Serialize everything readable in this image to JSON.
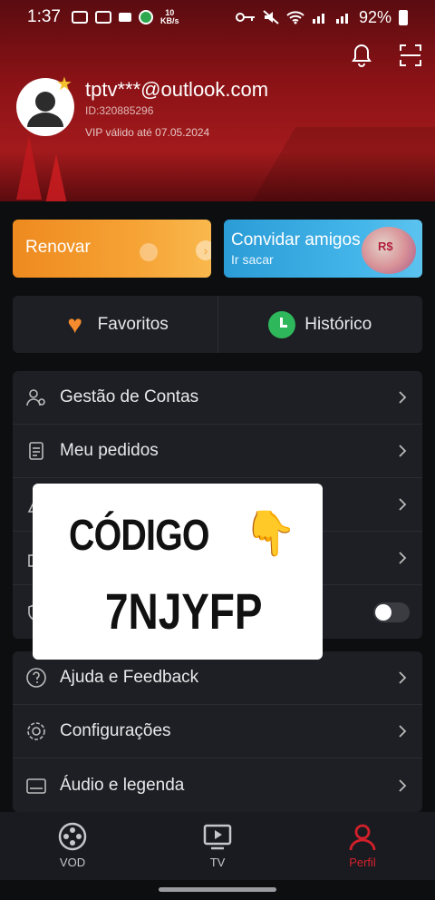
{
  "status_bar": {
    "time": "1:37",
    "speed": "10",
    "speed_unit": "KB/s",
    "battery": "92%"
  },
  "profile": {
    "email": "tptv***@outlook.com",
    "id": "ID:320885296",
    "vip": "VIP válido até 07.05.2024"
  },
  "cards": {
    "renew_label": "Renovar",
    "invite_label": "Convidar amigos",
    "invite_sub": "Ir sacar",
    "invite_badge": "R$"
  },
  "quick": {
    "favorites": "Favoritos",
    "history": "Histórico"
  },
  "menu": [
    {
      "label": "Gestão de Contas",
      "icon": "account-manage-icon"
    },
    {
      "label": "Meu pedidos",
      "icon": "orders-icon"
    },
    {
      "label": "",
      "icon": "item-icon"
    },
    {
      "label": "",
      "icon": "gift-icon"
    },
    {
      "label": "",
      "icon": "shield-icon",
      "toggle": false
    }
  ],
  "menu2": [
    {
      "label": "Ajuda e Feedback",
      "icon": "help-icon"
    },
    {
      "label": "Configurações",
      "icon": "settings-icon"
    },
    {
      "label": "Áudio e legenda",
      "icon": "subtitles-icon"
    }
  ],
  "overlay": {
    "title": "CÓDIGO",
    "code": "7NJYFP"
  },
  "bottom_nav": {
    "vod": "VOD",
    "tv": "TV",
    "profile": "Perfil"
  },
  "colors": {
    "accent": "#d3202b",
    "renew": "#f6a234",
    "invite": "#45b6ea",
    "panel": "#1d1f24"
  }
}
